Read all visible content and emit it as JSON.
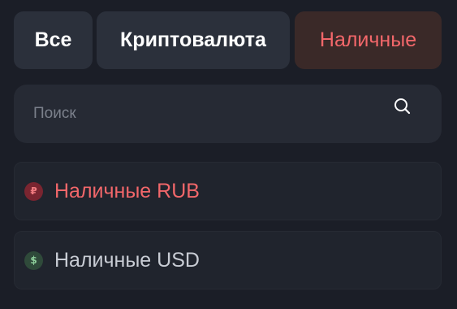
{
  "tabs": {
    "all": "Все",
    "crypto": "Криптовалюта",
    "cash": "Наличные",
    "active": "cash"
  },
  "search": {
    "placeholder": "Поиск",
    "value": ""
  },
  "currencies": [
    {
      "label": "Наличные RUB",
      "symbol": "₽",
      "selected": true,
      "accent": "#f2676a"
    },
    {
      "label": "Наличные USD",
      "symbol": "$",
      "selected": false,
      "accent": "#8fd19c"
    }
  ]
}
